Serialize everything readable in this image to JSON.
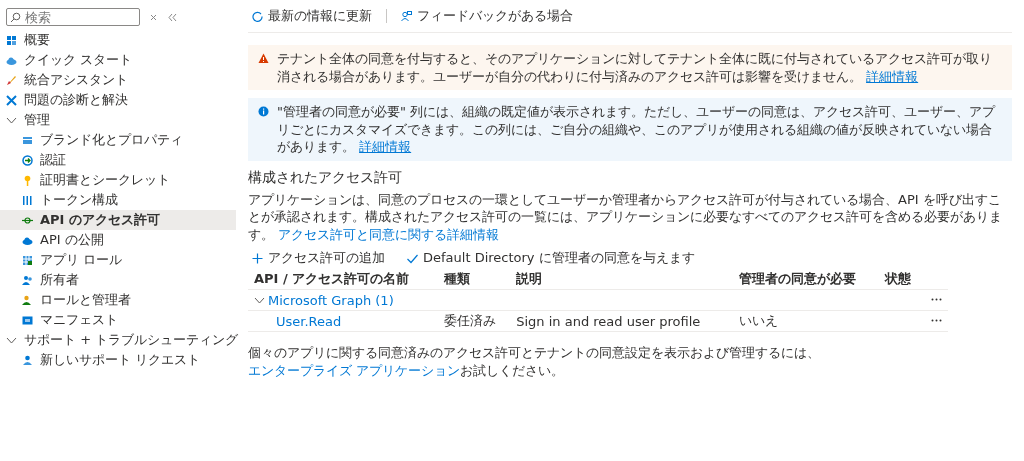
{
  "sidebar": {
    "search": {
      "placeholder": "検索"
    },
    "items": [
      {
        "kind": "overview",
        "label": "概要",
        "selected": false
      },
      {
        "kind": "quickstart",
        "label": "クイック スタート",
        "selected": false
      },
      {
        "kind": "assistant",
        "label": "統合アシスタント",
        "selected": false
      },
      {
        "kind": "diagnose",
        "label": "問題の診断と解決",
        "selected": false
      },
      {
        "kind": "group",
        "label": "管理",
        "expanded": true,
        "children": [
          {
            "kind": "branding",
            "label": "ブランド化とプロパティ",
            "selected": false
          },
          {
            "kind": "auth",
            "label": "認証",
            "selected": false
          },
          {
            "kind": "cert",
            "label": "証明書とシークレット",
            "selected": false
          },
          {
            "kind": "token",
            "label": "トークン構成",
            "selected": false
          },
          {
            "kind": "api",
            "label": "API のアクセス許可",
            "selected": true
          },
          {
            "kind": "expose",
            "label": "API の公開",
            "selected": false
          },
          {
            "kind": "roles",
            "label": "アプリ ロール",
            "selected": false
          },
          {
            "kind": "owners",
            "label": "所有者",
            "selected": false
          },
          {
            "kind": "admins",
            "label": "ロールと管理者",
            "selected": false
          },
          {
            "kind": "manifest",
            "label": "マニフェスト",
            "selected": false
          }
        ]
      },
      {
        "kind": "group",
        "label": "サポート + トラブルシューティング",
        "expanded": true,
        "children": [
          {
            "kind": "support",
            "label": "新しいサポート リクエスト",
            "selected": false
          }
        ]
      }
    ]
  },
  "toolbar": [
    {
      "kind": "refresh",
      "label": "最新の情報に更新"
    },
    {
      "kind": "feedback",
      "label": "フィードバックがある場合"
    }
  ],
  "banners": [
    {
      "kind": "warning",
      "text": "テナント全体の同意を付与すると、そのアプリケーションに対してテナント全体に既に付与されているアクセス許可が取り消される場合があります。ユーザーが自分の代わりに付与済みのアクセス許可は影響を受けません。",
      "link": "詳細情報"
    },
    {
      "kind": "info",
      "text": "\"管理者の同意が必要\" 列には、組織の既定値が表示されます。ただし、ユーザーの同意は、アクセス許可、ユーザー、アプリごとにカスタマイズできます。この列には、ご自分の組織や、このアプリが使用される組織の値が反映されていない場合があります。",
      "link": "詳細情報"
    }
  ],
  "section": {
    "title": "構成されたアクセス許可",
    "description": "アプリケーションは、同意のプロセスの一環としてユーザーか管理者からアクセス許可が付与されている場合、API を呼び出すことが承認されます。構成されたアクセス許可の一覧には、アプリケーションに必要なすべてのアクセス許可を含める必要があります。",
    "link": "アクセス許可と同意に関する詳細情報"
  },
  "actions": [
    {
      "kind": "add",
      "label": "アクセス許可の追加"
    },
    {
      "kind": "grant",
      "label": "Default Directory に管理者の同意を与えます"
    }
  ],
  "table": {
    "columns": [
      "API / アクセス許可の名前",
      "種類",
      "説明",
      "管理者の同意が必要",
      "状態"
    ],
    "groups": [
      {
        "name": "Microsoft Graph (1)",
        "expanded": true,
        "rows": [
          [
            "User.Read",
            "委任済み",
            "Sign in and read user profile",
            "いいえ",
            ""
          ]
        ]
      }
    ]
  },
  "footer": {
    "text": "個々のアプリに関する同意済みのアクセス許可とテナントの同意設定を表示および管理するには、",
    "link": "エンタープライズ アプリケーション",
    "suffix": "お試しください。"
  }
}
